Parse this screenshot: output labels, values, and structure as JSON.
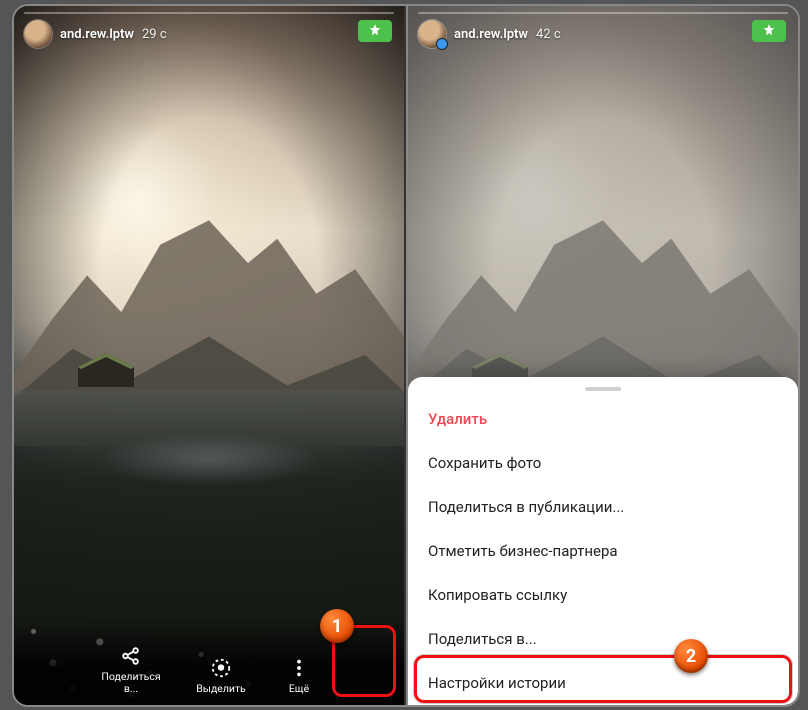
{
  "left": {
    "username": "and.rew.lptw",
    "timestamp": "29 с",
    "badge_icon": "star-icon",
    "toolbar": {
      "share": "Поделиться в...",
      "highlight": "Выделить",
      "more": "Ещё"
    }
  },
  "right": {
    "username": "and.rew.lptw",
    "timestamp": "42 с",
    "badge_icon": "star-icon",
    "sheet": {
      "delete": "Удалить",
      "save_photo": "Сохранить фото",
      "share_post": "Поделиться в публикации...",
      "tag_partner": "Отметить бизнес-партнера",
      "copy_link": "Копировать ссылку",
      "share_to": "Поделиться в...",
      "story_settings": "Настройки истории"
    }
  },
  "markers": {
    "one": "1",
    "two": "2"
  }
}
